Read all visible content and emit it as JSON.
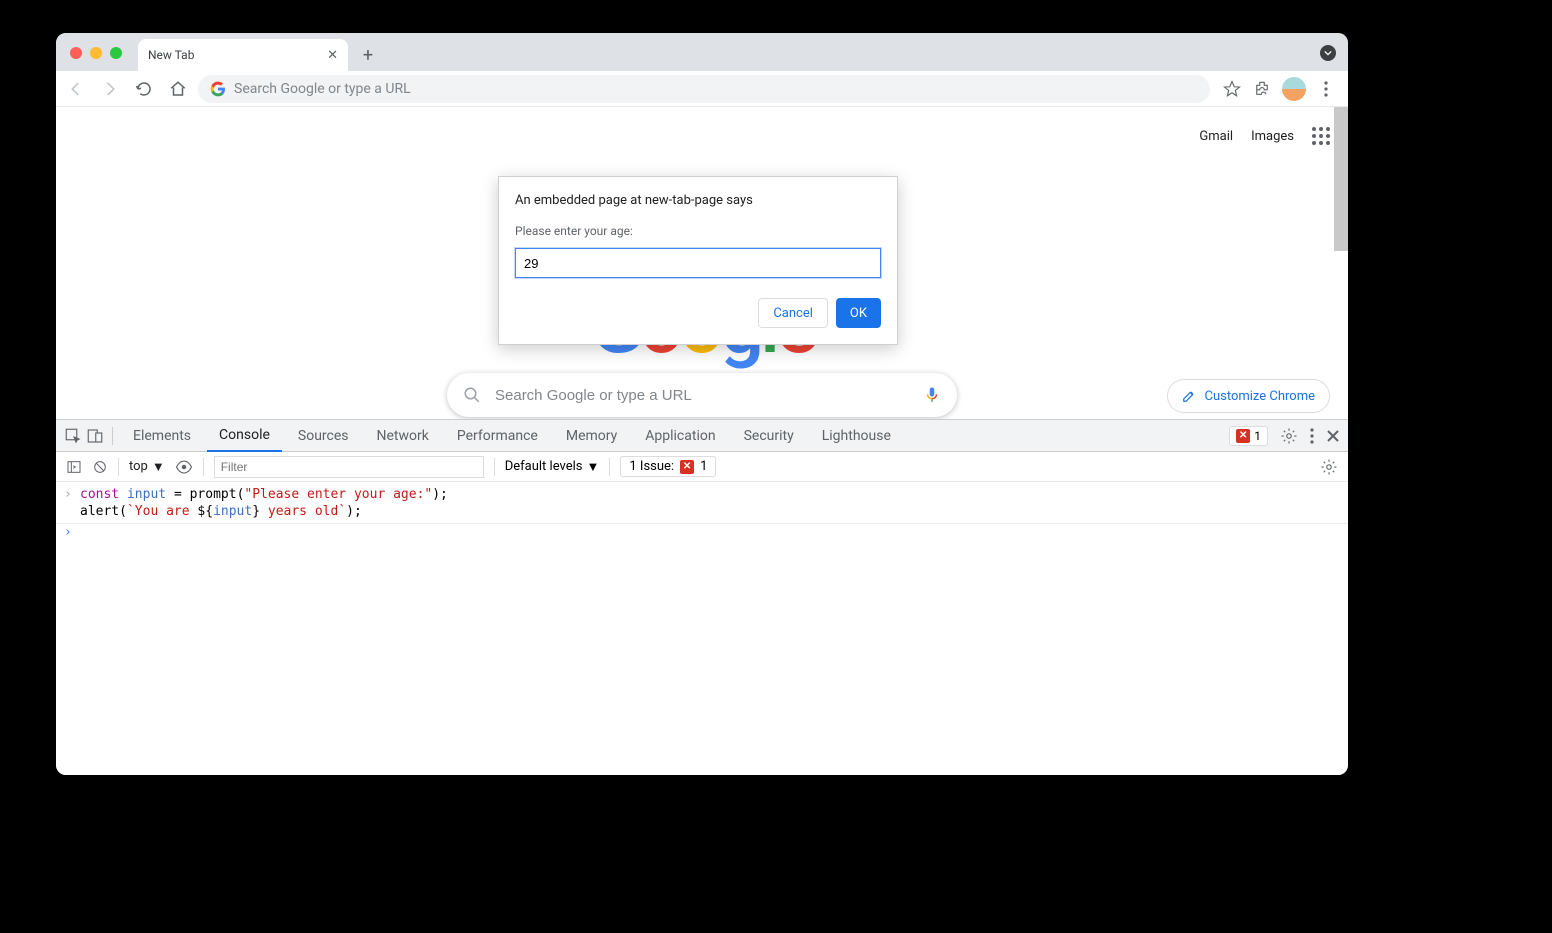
{
  "browser": {
    "tab_title": "New Tab",
    "omnibox_placeholder": "Search Google or type a URL"
  },
  "ntp": {
    "gmail": "Gmail",
    "images": "Images",
    "search_placeholder": "Search Google or type a URL",
    "customize": "Customize Chrome"
  },
  "dialog": {
    "title": "An embedded page at new-tab-page says",
    "label": "Please enter your age:",
    "input_value": "29",
    "cancel": "Cancel",
    "ok": "OK"
  },
  "devtools": {
    "tabs": [
      "Elements",
      "Console",
      "Sources",
      "Network",
      "Performance",
      "Memory",
      "Application",
      "Security",
      "Lighthouse"
    ],
    "active_tab": "Console",
    "issue_count": "1",
    "context": "top",
    "filter_placeholder": "Filter",
    "levels": "Default levels",
    "issues_label": "1 Issue:",
    "issues_count": "1",
    "code": {
      "l1_kw": "const",
      "l1_ident": " input ",
      "l1_eq": "= ",
      "l1_fn": "prompt",
      "l1_open": "(",
      "l1_str": "\"Please enter your age:\"",
      "l1_close": ");",
      "l2_fn": "alert",
      "l2_open": "(",
      "l2_tmpl1": "`You are ",
      "l2_interp_open": "${",
      "l2_interp_var": "input",
      "l2_interp_close": "}",
      "l2_tmpl2": " years old`",
      "l2_close": ");"
    }
  }
}
